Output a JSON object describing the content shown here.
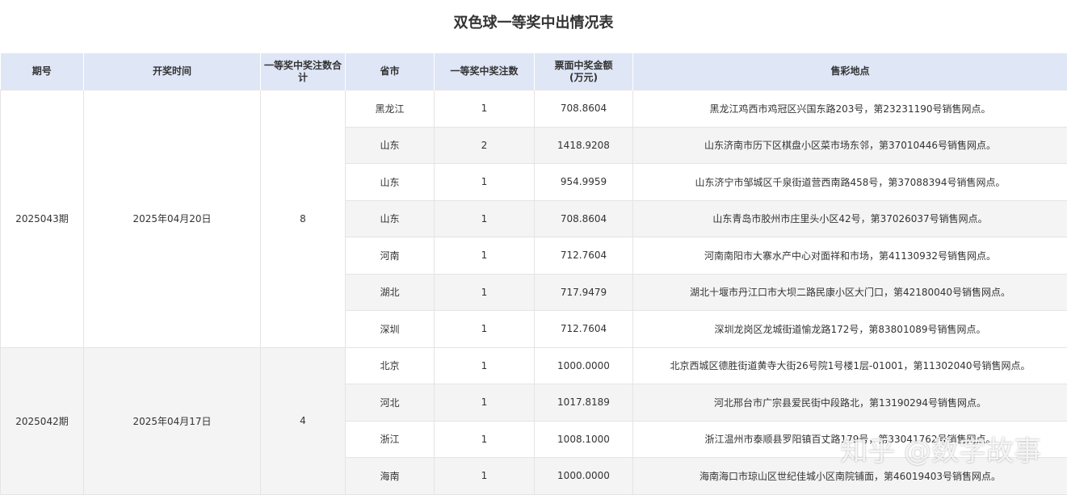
{
  "title": "双色球一等奖中出情况表",
  "headers": [
    "期号",
    "开奖时间",
    "一等奖中奖注数合计",
    "省市",
    "一等奖中奖注数",
    "票面中奖金额\n(万元)",
    "售彩地点"
  ],
  "draws": [
    {
      "issue": "2025043期",
      "date": "2025年04月20日",
      "total": "8",
      "rows": [
        {
          "prov": "黑龙江",
          "count": "1",
          "amount": "708.8604",
          "loc": "黑龙江鸡西市鸡冠区兴国东路203号，第23231190号销售网点。"
        },
        {
          "prov": "山东",
          "count": "2",
          "amount": "1418.9208",
          "loc": "山东济南市历下区棋盘小区菜市场东邻，第37010446号销售网点。"
        },
        {
          "prov": "山东",
          "count": "1",
          "amount": "954.9959",
          "loc": "山东济宁市邹城区千泉街道营西南路458号，第37088394号销售网点。"
        },
        {
          "prov": "山东",
          "count": "1",
          "amount": "708.8604",
          "loc": "山东青岛市胶州市庄里头小区42号，第37026037号销售网点。"
        },
        {
          "prov": "河南",
          "count": "1",
          "amount": "712.7604",
          "loc": "河南南阳市大寨水产中心对面祥和市场，第41130932号销售网点。"
        },
        {
          "prov": "湖北",
          "count": "1",
          "amount": "717.9479",
          "loc": "湖北十堰市丹江口市大坝二路民康小区大门口，第42180040号销售网点。"
        },
        {
          "prov": "深圳",
          "count": "1",
          "amount": "712.7604",
          "loc": "深圳龙岗区龙城街道愉龙路172号，第83801089号销售网点。"
        }
      ]
    },
    {
      "issue": "2025042期",
      "date": "2025年04月17日",
      "total": "4",
      "rows": [
        {
          "prov": "北京",
          "count": "1",
          "amount": "1000.0000",
          "loc": "北京西城区德胜街道黄寺大街26号院1号楼1层-01001，第11302040号销售网点。"
        },
        {
          "prov": "河北",
          "count": "1",
          "amount": "1017.8189",
          "loc": "河北邢台市广宗县爱民街中段路北，第13190294号销售网点。"
        },
        {
          "prov": "浙江",
          "count": "1",
          "amount": "1008.1000",
          "loc": "浙江温州市泰顺县罗阳镇百丈路179号，第33041762号销售网点。"
        },
        {
          "prov": "海南",
          "count": "1",
          "amount": "1000.0000",
          "loc": "海南海口市琼山区世纪佳城小区南院铺面，第46019403号销售网点。"
        }
      ]
    }
  ],
  "watermark": "知乎 @数字故事"
}
